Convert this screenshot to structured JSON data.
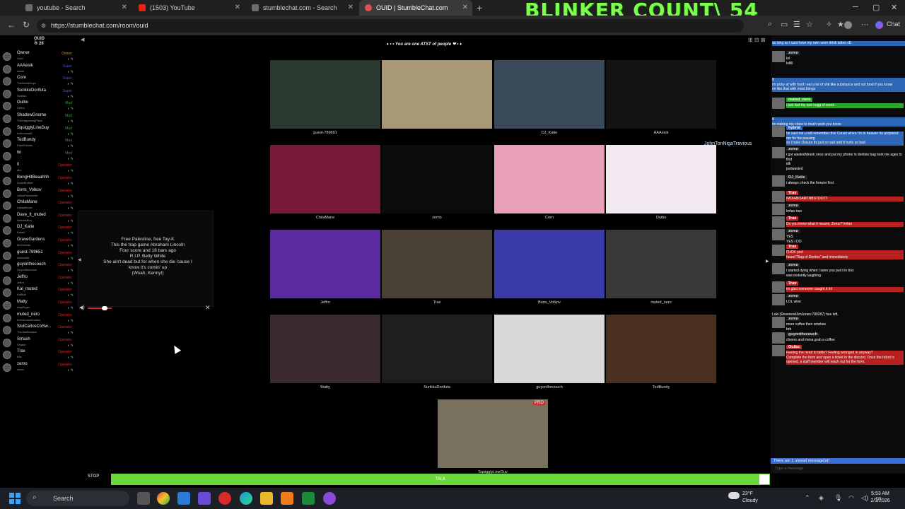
{
  "browser": {
    "tabs": [
      {
        "title": "youtube - Search",
        "icon_color": "#6b6b6b"
      },
      {
        "title": "(1503) YouTube",
        "icon_color": "#e62117"
      },
      {
        "title": "stumblechat.com - Search",
        "icon_color": "#6b6b6b"
      },
      {
        "title": "OUID | StumbleChat.com",
        "icon_color": "#e05050"
      }
    ],
    "overlay_title": "BLINKER COUNT\\ 54",
    "url": "https://stumblechat.com/room/ouid",
    "chat_button": "Chat"
  },
  "room": {
    "name": "OUID",
    "count": "☃ 26",
    "banner": "♦ • • You are one ATST of people ❤ • ♦"
  },
  "users": [
    {
      "name": "Owner",
      "sub": "Ouid",
      "badge": "Owner",
      "badge_color": "#c89a1a"
    },
    {
      "name": "AAAesik",
      "sub": "Aesik",
      "badge": "Super",
      "badge_color": "#3a5ad8"
    },
    {
      "name": "Corn",
      "sub": "TheWorldGuys",
      "badge": "Super",
      "badge_color": "#3a5ad8"
    },
    {
      "name": "SurikkuDorifuta",
      "sub": "Surikku",
      "badge": "Super",
      "badge_color": "#3a5ad8"
    },
    {
      "name": "Ouibo",
      "sub": "Ouibo",
      "badge": "Mod",
      "badge_color": "#2aa82a"
    },
    {
      "name": "ShadowGnome",
      "sub": "TheHappeningPlace",
      "badge": "Mod",
      "badge_color": "#2aa82a"
    },
    {
      "name": "SquigglyLineGuy",
      "sub": "AdAnxiousE",
      "badge": "Mod",
      "badge_color": "#2aa82a"
    },
    {
      "name": "TedBundy",
      "sub": "FakeFriends",
      "badge": "Mod",
      "badge_color": "#2aa82a"
    },
    {
      "name": "tin",
      "sub": "",
      "badge": "Mod",
      "badge_color": "#2aa82a"
    },
    {
      "name": "0",
      "sub": "abc",
      "badge": "Operator",
      "badge_color": "#d02a2a"
    },
    {
      "name": "BongHitBeaahhh",
      "sub": "DudeBrother",
      "badge": "Operator",
      "badge_color": "#d02a2a"
    },
    {
      "name": "Boris_Volkov",
      "sub": "JuliusPoindexter",
      "badge": "Operator",
      "badge_color": "#d02a2a"
    },
    {
      "name": "ChilaMane",
      "sub": "Lalapalooza",
      "badge": "Operator",
      "badge_color": "#d02a2a"
    },
    {
      "name": "Dave_It_muted",
      "sub": "NetherMind",
      "badge": "Operator",
      "badge_color": "#d02a2a"
    },
    {
      "name": "DJ_Katie",
      "sub": "KatieK",
      "badge": "Operator",
      "badge_color": "#d02a2a"
    },
    {
      "name": "GraveGardens",
      "sub": "MoOnNote",
      "badge": "Operator",
      "badge_color": "#d02a2a"
    },
    {
      "name": "guest-789651",
      "sub": "lurkerside",
      "badge": "Operator",
      "badge_color": "#d02a2a"
    },
    {
      "name": "guyonthecouch",
      "sub": "Guyonthecouch",
      "badge": "Operator",
      "badge_color": "#d02a2a"
    },
    {
      "name": "Jeffro",
      "sub": "Jeffro",
      "badge": "Operator",
      "badge_color": "#d02a2a"
    },
    {
      "name": "Kal_muted",
      "sub": "KaliKal",
      "badge": "Operator",
      "badge_color": "#d02a2a"
    },
    {
      "name": "Matty",
      "sub": "kingRoger",
      "badge": "Operator",
      "badge_color": "#d02a2a"
    },
    {
      "name": "muted_nero",
      "sub": "freedomandmotion",
      "badge": "Operator",
      "badge_color": "#d02a2a"
    },
    {
      "name": "SlutCarlosCoSw...",
      "sub": "TheJawBreaker",
      "badge": "Operator",
      "badge_color": "#d02a2a"
    },
    {
      "name": "Smash",
      "sub": "Smash",
      "badge": "Operator",
      "badge_color": "#d02a2a"
    },
    {
      "name": "Trax",
      "sub": "trax",
      "badge": "Operator",
      "badge_color": "#d02a2a"
    },
    {
      "name": "zemo",
      "sub": "zemo",
      "badge": "Operator",
      "badge_color": "#d02a2a"
    }
  ],
  "lyrics": {
    "text": "Free Palestine, free Tay-K\nThis the trap game Abraham Lincoln\nFour score and 16 bars ago\nR.I.P. Betty White\nShe ain't dead but for when she die 'cause I\nknow it's comin' up\n(Woah, Kenny!)"
  },
  "cams": [
    {
      "name": "guest-789651",
      "bg": "#2b3a30"
    },
    {
      "name": "",
      "bg": "#a89878"
    },
    {
      "name": "DJ_Katie",
      "bg": "#3a4a58"
    },
    {
      "name": "AAAesik",
      "bg": "#141414"
    },
    {
      "name": "ChilaMane",
      "bg": "#7a1a3a"
    },
    {
      "name": "zemo",
      "bg": "#0b0b0b"
    },
    {
      "name": "Corn",
      "bg": "#e8a0b8"
    },
    {
      "name": "Ouibo",
      "bg": "#f2e8f2"
    },
    {
      "name": "Jeffro",
      "bg": "#5a2aa0"
    },
    {
      "name": "Trax",
      "bg": "#4a4036"
    },
    {
      "name": "Boris_Volkov",
      "bg": "#3a3aa8"
    },
    {
      "name": "muted_nero",
      "bg": "#3a3a38"
    },
    {
      "name": "Matty",
      "bg": "#3a2a30"
    },
    {
      "name": "SurikkuDorifuta",
      "bg": "#1e1e1e"
    },
    {
      "name": "guyonthecouch",
      "bg": "#d8d8d8"
    },
    {
      "name": "TedBundy",
      "bg": "#4a3020"
    },
    {
      "name": "SquigglyLineGuy",
      "bg": "#7a7060",
      "pro": "PRO"
    }
  ],
  "floating_name": "JohnTonNigaTravious",
  "chat": [
    {
      "name": "",
      "text": "as long as i cant have my own vmm drink lattes xD",
      "style": "blue"
    },
    {
      "name": "zemo",
      "text": "lol\nlolllll",
      "style": "plain"
    },
    {
      "name": "",
      "text": "8\nim picky af with food i eat a lot of shit like substance and not food if you know\nim like that with most things",
      "style": "blue"
    },
    {
      "name": "muted_nero",
      "text": "i just lost my last nugg of weed",
      "style": "green"
    },
    {
      "name": "",
      "text": "8\nits making me chew to much work you know",
      "style": "blue"
    },
    {
      "name": "hybrid",
      "text": "he said me u will remember this Convo when i'm in heaven he prepared me for his passing\nso i have closure its just so sad and it hurts so bad",
      "style": "blue"
    },
    {
      "name": "zemo",
      "text": "i got wasted/drunk once and put my phone in doritios bag took me ages to find\nidk\njustwasted",
      "style": "plain"
    },
    {
      "name": "DJ_Katie",
      "text": "i always check the freezer first",
      "style": "plain"
    },
    {
      "name": "Trax",
      "text": "IMDIABOAMTNBSTDOTT",
      "style": "red"
    },
    {
      "name": "zemo",
      "text": "lmfao trax",
      "style": "plain"
    },
    {
      "name": "Trax",
      "text": "Do you know what it means, Zemo? lmfao",
      "style": "red"
    },
    {
      "name": "zemo",
      "text": "YES\nYES I DO",
      "style": "plain"
    },
    {
      "name": "Trax",
      "text": "FUCK yes!\nheard \"Bag of Doritos\" and immediately",
      "style": "red"
    },
    {
      "name": "zemo",
      "text": "i started dying when i seen you put it in box\nwas instantly laughing",
      "style": "plain"
    },
    {
      "name": "Trax",
      "text": "im glad someone caught it lol",
      "style": "red"
    },
    {
      "name": "zemo",
      "text": "LOL wine",
      "style": "plain"
    },
    {
      "name": "",
      "text": "Loki (ReverendJimJones:789287) has left.",
      "style": "plain"
    },
    {
      "name": "zemo",
      "text": "more coffee then smokes\nbrb",
      "style": "plain"
    },
    {
      "name": "guyonthecouch",
      "text": "cheers and imma grab a coffee",
      "style": "plain"
    },
    {
      "name": "Ouibo",
      "text": "Feeling the need to tattle? Feeling wronged in anyway?\nComplete the form and open a ticket in the discord. Once the ticket is opened, a staff member will reach out for the form.",
      "style": "red"
    }
  ],
  "chat_unread": "There are 1 unread message(s)!",
  "chat_placeholder": "Type a message",
  "talk": {
    "stop": "STOP",
    "label": "TALK"
  },
  "taskbar": {
    "search": "Search",
    "temp": "23°F",
    "weather": "Cloudy",
    "time": "5:53 AM",
    "date": "2/3/2026"
  }
}
